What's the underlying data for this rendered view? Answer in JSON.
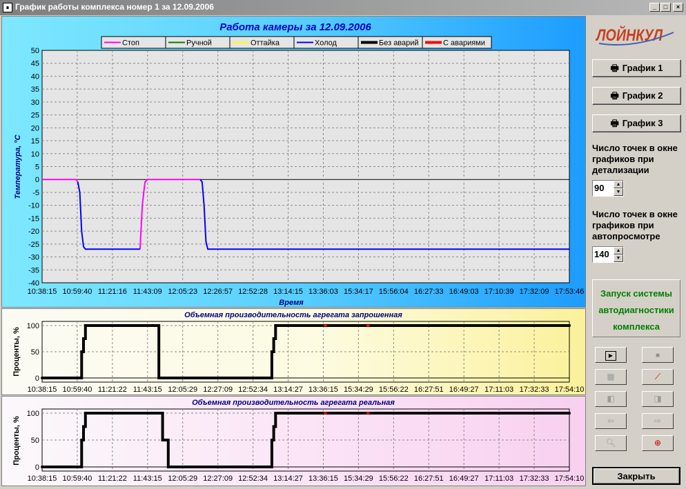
{
  "window": {
    "title": "График работы комплекса номер 1 за 12.09.2006",
    "icon_text": "⏸"
  },
  "main_chart": {
    "title": "Работа камеры за 12.09.2006",
    "xlabel": "Время",
    "ylabel": "Температура, °С",
    "legend": [
      {
        "label": "Стоп",
        "color": "#ff00ff"
      },
      {
        "label": "Ручной",
        "color": "#008000"
      },
      {
        "label": "Оттайка",
        "color": "#ffff00"
      },
      {
        "label": "Холод",
        "color": "#0000ff"
      },
      {
        "label": "Без аварий",
        "color": "#000000"
      },
      {
        "label": "С авариями",
        "color": "#ff0000"
      }
    ],
    "y_ticks": [
      "50",
      "45",
      "40",
      "35",
      "30",
      "25",
      "20",
      "15",
      "10",
      "5",
      "0",
      "-5",
      "-10",
      "-15",
      "-20",
      "-25",
      "-30",
      "-35",
      "-40"
    ],
    "x_ticks": [
      "10:38:15",
      "10:59:40",
      "11:21:16",
      "11:43:09",
      "12:05:23",
      "12:26:57",
      "12:52:28",
      "13:14:15",
      "13:36:03",
      "15:34:17",
      "15:56:04",
      "16:27:33",
      "16:49:03",
      "17:10:39",
      "17:32:09",
      "17:53:46"
    ]
  },
  "req_chart": {
    "title": "Объемная производительность агрегата запрошенная",
    "ylabel": "Проценты, %",
    "y_ticks": [
      "100",
      "50",
      "0"
    ],
    "x_ticks": [
      "10:38:15",
      "10:59:40",
      "11:21:22",
      "11:43:15",
      "12:05:29",
      "12:27:09",
      "12:52:34",
      "13:14:27",
      "13:36:15",
      "15:34:29",
      "15:56:22",
      "16:27:51",
      "16:49:27",
      "17:11:03",
      "17:32:33",
      "17:54:10"
    ]
  },
  "real_chart": {
    "title": "Объемная производительность агрегата реальная",
    "ylabel": "Проценты, %",
    "y_ticks": [
      "100",
      "50",
      "0"
    ],
    "x_ticks": [
      "10:38:15",
      "10:59:40",
      "11:21:22",
      "11:43:15",
      "12:05:29",
      "12:27:09",
      "12:52:34",
      "13:14:27",
      "13:36:15",
      "15:34:29",
      "15:56:22",
      "16:27:51",
      "16:49:27",
      "17:11:03",
      "17:32:33",
      "17:54:10"
    ]
  },
  "chart_data": [
    {
      "type": "line",
      "title": "Работа камеры за 12.09.2006",
      "xlabel": "Время",
      "ylabel": "Температура, °С",
      "ylim": [
        -40,
        50
      ],
      "x_unit": "point index",
      "xlim": [
        0,
        140
      ],
      "grid": true,
      "legend_position": "top",
      "series": [
        {
          "name": "Стоп",
          "color": "#ff00ff",
          "segments": [
            [
              [
                0,
                0
              ],
              [
                9,
                0
              ],
              [
                9.5,
                -1
              ]
            ],
            [
              [
                26,
                -27
              ],
              [
                26.6,
                -10
              ],
              [
                27.3,
                -1
              ],
              [
                28,
                0
              ],
              [
                42,
                0
              ]
            ]
          ]
        },
        {
          "name": "Холод",
          "color": "#0000ff",
          "segments": [
            [
              [
                9.5,
                -1
              ],
              [
                10,
                -5
              ],
              [
                10.5,
                -20
              ],
              [
                11,
                -26
              ],
              [
                11.5,
                -27
              ],
              [
                26,
                -27
              ]
            ],
            [
              [
                42,
                0
              ],
              [
                42.5,
                -1
              ],
              [
                43,
                -10
              ],
              [
                43.5,
                -24
              ],
              [
                44,
                -27
              ],
              [
                140,
                -27
              ]
            ]
          ]
        }
      ]
    },
    {
      "type": "line",
      "title": "Объемная производительность агрегата запрошенная",
      "ylabel": "Проценты, %",
      "ylim": [
        0,
        100
      ],
      "xlim": [
        0,
        140
      ],
      "series": [
        {
          "name": "Без аварий",
          "color": "#000000",
          "points": [
            [
              0,
              0
            ],
            [
              10.5,
              0
            ],
            [
              10.5,
              50
            ],
            [
              11,
              50
            ],
            [
              11,
              75
            ],
            [
              11.5,
              75
            ],
            [
              11.5,
              100
            ],
            [
              31,
              100
            ],
            [
              31,
              0
            ],
            [
              61,
              0
            ],
            [
              61,
              50
            ],
            [
              61.5,
              50
            ],
            [
              61.5,
              75
            ],
            [
              62,
              75
            ],
            [
              62,
              100
            ],
            [
              140,
              100
            ]
          ]
        },
        {
          "name": "С авариями",
          "color": "#ff0000",
          "points": [
            [
              75,
              100
            ],
            [
              92,
              100
            ]
          ]
        }
      ]
    },
    {
      "type": "line",
      "title": "Объемная производительность агрегата реальная",
      "ylabel": "Проценты, %",
      "ylim": [
        0,
        100
      ],
      "xlim": [
        0,
        140
      ],
      "series": [
        {
          "name": "Без аварий",
          "color": "#000000",
          "points": [
            [
              0,
              0
            ],
            [
              10.5,
              0
            ],
            [
              10.5,
              50
            ],
            [
              11,
              50
            ],
            [
              11,
              75
            ],
            [
              11.5,
              75
            ],
            [
              11.5,
              100
            ],
            [
              32,
              100
            ],
            [
              32,
              50
            ],
            [
              33.5,
              50
            ],
            [
              33.5,
              0
            ],
            [
              61,
              0
            ],
            [
              61,
              50
            ],
            [
              61.5,
              50
            ],
            [
              61.5,
              75
            ],
            [
              62,
              75
            ],
            [
              62,
              100
            ],
            [
              140,
              100
            ]
          ]
        },
        {
          "name": "С авариями",
          "color": "#ff0000",
          "points": [
            [
              75,
              100
            ],
            [
              92,
              100
            ]
          ]
        }
      ]
    }
  ],
  "sidebar": {
    "logo_text": "ЛОЙНКУЛ",
    "graph1": "График 1",
    "graph2": "График 2",
    "graph3": "График 3",
    "points_detail_label": "Число точек в окне графиков при детализации",
    "points_detail_value": "90",
    "points_auto_label": "Число точек в окне графиков при автопросмотре",
    "points_auto_value": "140",
    "diag_label": "Запуск системы автодиагностики комплекса",
    "close_label": "Закрыть"
  }
}
